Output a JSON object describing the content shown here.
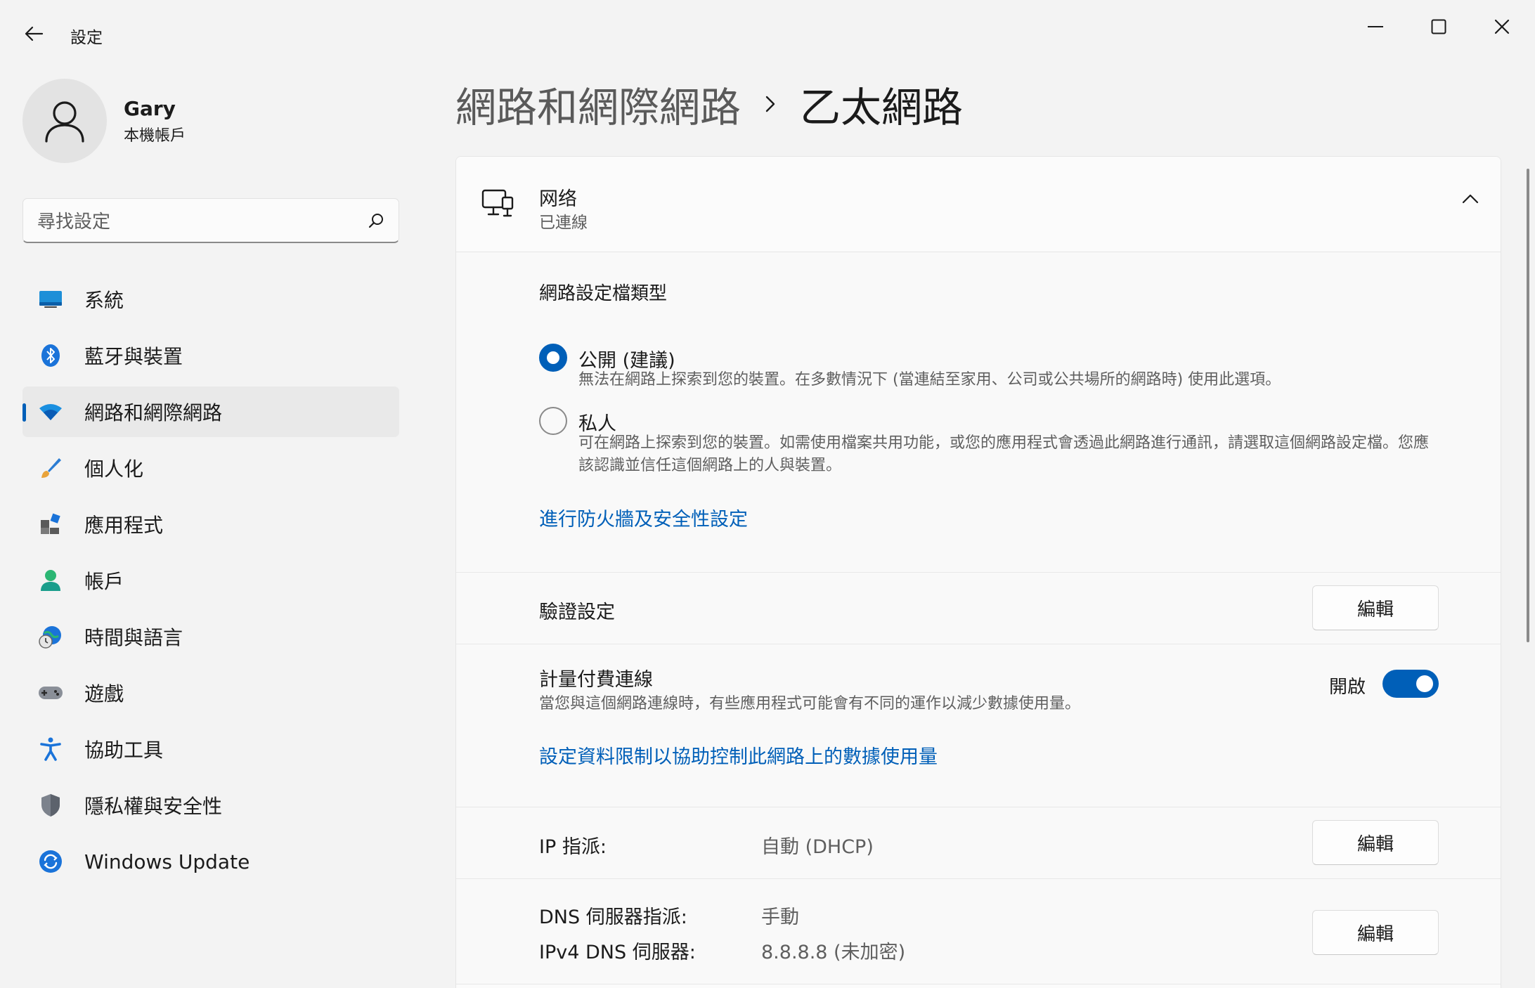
{
  "app": {
    "title": "設定"
  },
  "profile": {
    "name": "Gary",
    "account_type": "本機帳戶"
  },
  "search": {
    "placeholder": "尋找設定"
  },
  "sidebar": {
    "items": [
      {
        "label": "系統",
        "icon": "monitor-icon"
      },
      {
        "label": "藍牙與裝置",
        "icon": "bluetooth-icon"
      },
      {
        "label": "網路和網際網路",
        "icon": "wifi-icon",
        "active": true
      },
      {
        "label": "個人化",
        "icon": "brush-icon"
      },
      {
        "label": "應用程式",
        "icon": "apps-icon"
      },
      {
        "label": "帳戶",
        "icon": "person-icon"
      },
      {
        "label": "時間與語言",
        "icon": "globe-clock-icon"
      },
      {
        "label": "遊戲",
        "icon": "gamepad-icon"
      },
      {
        "label": "協助工具",
        "icon": "accessibility-icon"
      },
      {
        "label": "隱私權與安全性",
        "icon": "shield-icon"
      },
      {
        "label": "Windows Update",
        "icon": "update-icon"
      }
    ]
  },
  "breadcrumb": {
    "parent": "網路和網際網路",
    "current": "乙太網路"
  },
  "network": {
    "name": "网络",
    "status": "已連線",
    "profile_type": {
      "title": "網路設定檔類型",
      "options": [
        {
          "label": "公開 (建議)",
          "description": "無法在網路上探索到您的裝置。在多數情況下 (當連結至家用、公司或公共場所的網路時) 使用此選項。",
          "selected": true
        },
        {
          "label": "私人",
          "description": "可在網路上探索到您的裝置。如需使用檔案共用功能，或您的應用程式會透過此網路進行通訊，請選取這個網路設定檔。您應該認識並信任這個網路上的人與裝置。",
          "selected": false
        }
      ],
      "firewall_link": "進行防火牆及安全性設定"
    },
    "auth": {
      "label": "驗證設定",
      "button": "編輯"
    },
    "metered": {
      "label": "計量付費連線",
      "description": "當您與這個網路連線時，有些應用程式可能會有不同的運作以減少數據使用量。",
      "state_label": "開啟",
      "enabled": true,
      "data_limit_link": "設定資料限制以協助控制此網路上的數據使用量"
    },
    "ip": {
      "label": "IP 指派:",
      "value": "自動 (DHCP)",
      "button": "編輯"
    },
    "dns": {
      "label": "DNS 伺服器指派:",
      "value": "手動",
      "ipv4_label": "IPv4 DNS 伺服器:",
      "ipv4_value": "8.8.8.8 (未加密)",
      "button": "編輯"
    }
  },
  "colors": {
    "accent": "#005fb8",
    "background": "#f3f3f3",
    "card": "#fbfbfb"
  }
}
